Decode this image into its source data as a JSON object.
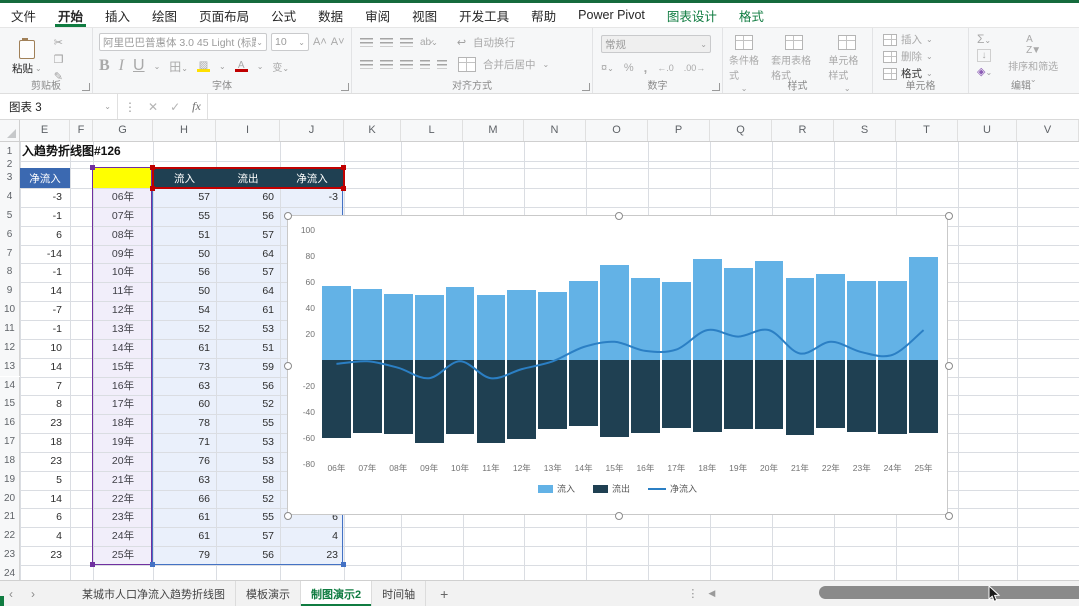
{
  "app": {
    "accent_color": "#107c41",
    "name_box": "图表 3",
    "fx_label": "fx",
    "formula_value": ""
  },
  "menu_tabs": [
    {
      "label": "文件",
      "state": "normal"
    },
    {
      "label": "开始",
      "state": "active"
    },
    {
      "label": "插入",
      "state": "normal"
    },
    {
      "label": "绘图",
      "state": "normal"
    },
    {
      "label": "页面布局",
      "state": "normal"
    },
    {
      "label": "公式",
      "state": "normal"
    },
    {
      "label": "数据",
      "state": "normal"
    },
    {
      "label": "审阅",
      "state": "normal"
    },
    {
      "label": "视图",
      "state": "normal"
    },
    {
      "label": "开发工具",
      "state": "normal"
    },
    {
      "label": "帮助",
      "state": "normal"
    },
    {
      "label": "Power Pivot",
      "state": "normal"
    },
    {
      "label": "图表设计",
      "state": "contextual"
    },
    {
      "label": "格式",
      "state": "contextual"
    }
  ],
  "ribbon": {
    "clipboard": {
      "label": "剪贴板",
      "paste": "粘贴"
    },
    "font": {
      "label": "字体",
      "name": "阿里巴巴普惠体 3.0 45 Light (标题",
      "size": "10"
    },
    "alignment": {
      "label": "对齐方式",
      "wrap_text": "自动换行",
      "merge_center": "合并后居中"
    },
    "number": {
      "label": "数字",
      "format": "常规"
    },
    "styles": {
      "label": "样式",
      "items": [
        "条件格式",
        "套用表格格式",
        "单元格样式"
      ]
    },
    "cells": {
      "label": "单元格",
      "items": [
        "插入",
        "删除",
        "格式"
      ]
    },
    "editing": {
      "label": "编辑",
      "sort_filter": "排序和筛选"
    }
  },
  "grid": {
    "col_letters": [
      "E",
      "F",
      "G",
      "H",
      "I",
      "J",
      "K",
      "L",
      "M",
      "N",
      "O",
      "P",
      "Q",
      "R",
      "S",
      "T",
      "U",
      "V"
    ],
    "title_cell_text": "入趋势折线图#126",
    "header_row": {
      "e": "净流入",
      "g": "",
      "h": "流入",
      "i": "流出",
      "j": "净流入"
    },
    "rows": [
      {
        "n": 4,
        "e": "-3",
        "g": "06年",
        "h": "57",
        "i": "60",
        "j": "-3"
      },
      {
        "n": 5,
        "e": "-1",
        "g": "07年",
        "h": "55",
        "i": "56",
        "j": ""
      },
      {
        "n": 6,
        "e": "6",
        "g": "08年",
        "h": "51",
        "i": "57",
        "j": ""
      },
      {
        "n": 7,
        "e": "-14",
        "g": "09年",
        "h": "50",
        "i": "64",
        "j": ""
      },
      {
        "n": 8,
        "e": "-1",
        "g": "10年",
        "h": "56",
        "i": "57",
        "j": ""
      },
      {
        "n": 9,
        "e": "14",
        "g": "11年",
        "h": "50",
        "i": "64",
        "j": ""
      },
      {
        "n": 10,
        "e": "-7",
        "g": "12年",
        "h": "54",
        "i": "61",
        "j": ""
      },
      {
        "n": 11,
        "e": "-1",
        "g": "13年",
        "h": "52",
        "i": "53",
        "j": ""
      },
      {
        "n": 12,
        "e": "10",
        "g": "14年",
        "h": "61",
        "i": "51",
        "j": ""
      },
      {
        "n": 13,
        "e": "14",
        "g": "15年",
        "h": "73",
        "i": "59",
        "j": ""
      },
      {
        "n": 14,
        "e": "7",
        "g": "16年",
        "h": "63",
        "i": "56",
        "j": ""
      },
      {
        "n": 15,
        "e": "8",
        "g": "17年",
        "h": "60",
        "i": "52",
        "j": ""
      },
      {
        "n": 16,
        "e": "23",
        "g": "18年",
        "h": "78",
        "i": "55",
        "j": ""
      },
      {
        "n": 17,
        "e": "18",
        "g": "19年",
        "h": "71",
        "i": "53",
        "j": ""
      },
      {
        "n": 18,
        "e": "23",
        "g": "20年",
        "h": "76",
        "i": "53",
        "j": ""
      },
      {
        "n": 19,
        "e": "5",
        "g": "21年",
        "h": "63",
        "i": "58",
        "j": ""
      },
      {
        "n": 20,
        "e": "14",
        "g": "22年",
        "h": "66",
        "i": "52",
        "j": "14"
      },
      {
        "n": 21,
        "e": "6",
        "g": "23年",
        "h": "61",
        "i": "55",
        "j": "6"
      },
      {
        "n": 22,
        "e": "4",
        "g": "24年",
        "h": "61",
        "i": "57",
        "j": "4"
      },
      {
        "n": 23,
        "e": "23",
        "g": "25年",
        "h": "79",
        "i": "56",
        "j": "23"
      }
    ],
    "colors": {
      "e_header_fill": "#3b69b1",
      "dark_header_fill": "#1f4052",
      "yellow_fill": "#ffff00",
      "purple_range": "#7030a0",
      "blue_range": "#4472c4",
      "red_range": "#c00000",
      "lavender_fill": "#f1eefa",
      "lightblue_fill": "#eaf0fb"
    }
  },
  "chart_data": {
    "type": "bar",
    "title": "",
    "categories": [
      "06年",
      "07年",
      "08年",
      "09年",
      "10年",
      "11年",
      "12年",
      "13年",
      "14年",
      "15年",
      "16年",
      "17年",
      "18年",
      "19年",
      "20年",
      "21年",
      "22年",
      "23年",
      "24年",
      "25年"
    ],
    "series": [
      {
        "name": "流入",
        "type": "bar",
        "color": "#63b2e6",
        "values": [
          57,
          55,
          51,
          50,
          56,
          50,
          54,
          52,
          61,
          73,
          63,
          60,
          78,
          71,
          76,
          63,
          66,
          61,
          61,
          79
        ]
      },
      {
        "name": "流出",
        "type": "bar",
        "color": "#1f4052",
        "values": [
          -60,
          -56,
          -57,
          -64,
          -57,
          -64,
          -61,
          -53,
          -51,
          -59,
          -56,
          -52,
          -55,
          -53,
          -53,
          -58,
          -52,
          -55,
          -57,
          -56
        ]
      },
      {
        "name": "净流入",
        "type": "line",
        "color": "#2b7fc4",
        "smooth": true,
        "values": [
          -3,
          -1,
          -6,
          -14,
          -1,
          -14,
          -7,
          -1,
          10,
          14,
          7,
          8,
          23,
          18,
          23,
          5,
          14,
          6,
          4,
          23
        ]
      }
    ],
    "ylim": [
      -80,
      100
    ],
    "yticks": [
      100,
      80,
      60,
      40,
      20,
      -20,
      -40,
      -60,
      -80
    ],
    "grid": false,
    "legend_position": "bottom"
  },
  "sheet_tabs": {
    "tabs": [
      {
        "label": "某城市人口净流入趋势折线图",
        "active": false
      },
      {
        "label": "模板演示",
        "active": false
      },
      {
        "label": "制图演示2",
        "active": true
      },
      {
        "label": "时间轴",
        "active": false
      }
    ],
    "add_label": "+"
  }
}
